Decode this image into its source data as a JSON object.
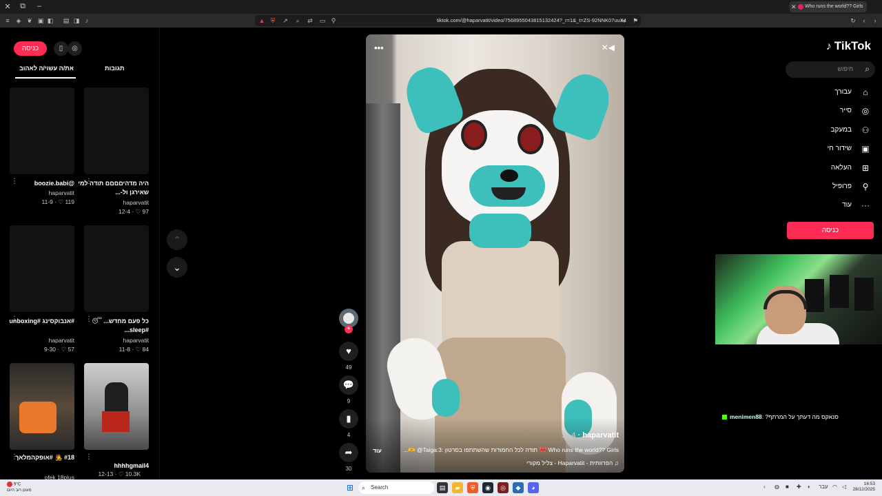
{
  "browser": {
    "tab_title": "Who runs the world?? Girls",
    "url": "tiktok.com/@haparvatit/video/7568955043815132424?_r=1&_t=ZS-92NNK07uuX4"
  },
  "left_panel": {
    "login_label": "כניסה",
    "tabs": [
      "את/ה עשוי/ה לאהוב",
      "תגובות"
    ],
    "videos": [
      {
        "caption": "היה מדהיםםםם תודה למי שאירגן ול-...",
        "author": "haparvatit",
        "likes": "97",
        "date": "12-4"
      },
      {
        "caption": "@boozie.babi",
        "author": "haparvatit",
        "likes": "119",
        "date": "11-9"
      },
      {
        "caption": "כל פעם מחדש... 😴 #sleep...",
        "author": "haparvatit",
        "likes": "84",
        "date": "11-8"
      },
      {
        "caption": "#אנבוקסינג #unboxing",
        "author": "haparvatit",
        "likes": "57",
        "date": "9-30"
      },
      {
        "caption": "hhhhgmail4",
        "author": "",
        "likes": "10.3K",
        "date": "12-13"
      },
      {
        "caption": "#18 🧑‍🎤 #אופקהמלאך",
        "author": "ofek 18plus",
        "likes": "",
        "date": ""
      }
    ]
  },
  "video": {
    "author": "haparvatit",
    "date": "11-4",
    "description": "Who runs the world?? Girls 🎀 תודה לכל החמודות שהשתתפו בסרטון :Taiga:3@ 🫶...",
    "more_label": "עוד",
    "music": "♫ הפרוותית - Haparvatit - צליל מקורי"
  },
  "actions": {
    "likes": "49",
    "comments": "9",
    "saves": "4",
    "shares": "30"
  },
  "sidebar": {
    "logo": "TikTok",
    "search_placeholder": "חיפוש",
    "items": [
      {
        "label": "עבורך",
        "icon": "home-icon"
      },
      {
        "label": "סייר",
        "icon": "compass-icon"
      },
      {
        "label": "במעקב",
        "icon": "following-icon"
      },
      {
        "label": "שידור חי",
        "icon": "live-icon"
      },
      {
        "label": "העלאה",
        "icon": "upload-icon"
      },
      {
        "label": "פרופיל",
        "icon": "profile-icon"
      },
      {
        "label": "עוד",
        "icon": "more-icon"
      }
    ],
    "login_label": "כניסה"
  },
  "chat": {
    "user": "menimen88",
    "message": "?סנאקס מה דעתך על המרתף"
  },
  "taskbar": {
    "weather_temp": "9°C",
    "weather_desc": "מעונן רוב היום",
    "search_placeholder": "Search",
    "lang": "עבר",
    "time": "16:53",
    "date": "28/12/2025"
  },
  "colors": {
    "accent": "#fe2c55",
    "background": "#000000"
  }
}
